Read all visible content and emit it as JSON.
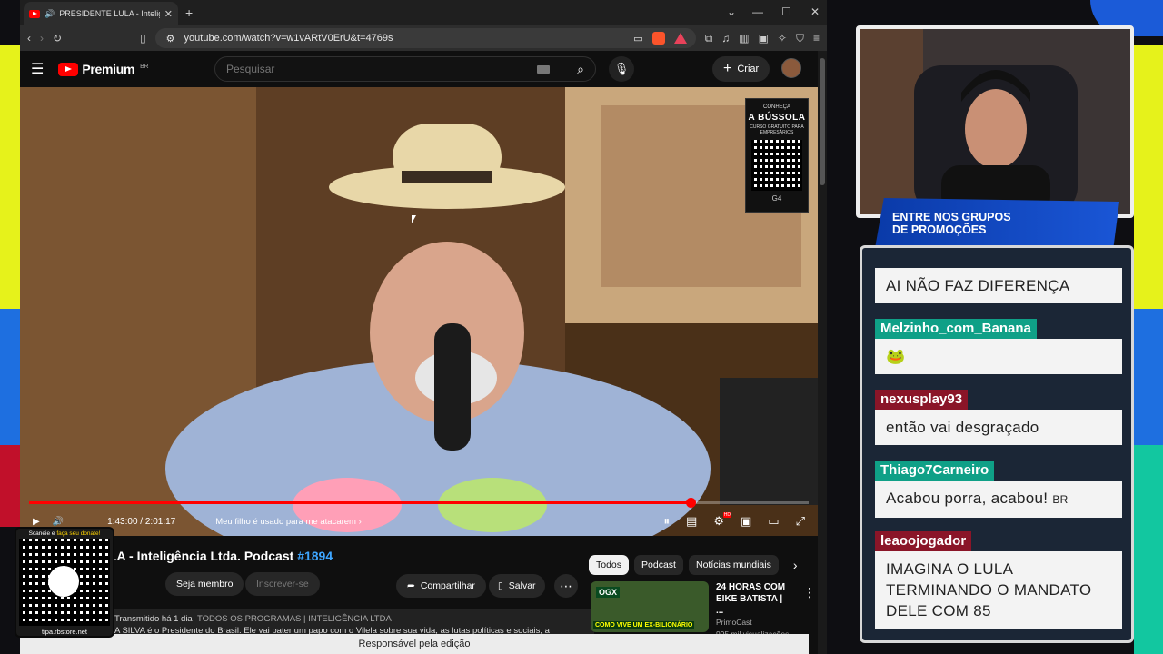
{
  "browser": {
    "tab_title": "PRESIDENTE LULA - Inteligência Ltd",
    "url": "youtube.com/watch?v=w1vARtV0ErU&t=4769s",
    "status_bar": "Responsável pela edição"
  },
  "youtube": {
    "logo_text": "Premium",
    "logo_region": "BR",
    "search_placeholder": "Pesquisar",
    "create_label": "Criar"
  },
  "ad_overlay": {
    "line1": "CONHEÇA",
    "brand": "A BÚSSOLA",
    "line2": "CURSO GRATUITO PARA EMPRESÁRIOS",
    "footer": "G4"
  },
  "player": {
    "time": "1:43:00 / 2:01:17",
    "chapter": "Meu filho é usado para me atacarem",
    "progress": 0.849
  },
  "video": {
    "title": "LA - Inteligência Ltda. Podcast ",
    "title_tag": "#1894",
    "member_label": "Seja membro",
    "subscribe_label": "Inscrever-se",
    "share_label": "Compartilhar",
    "save_label": "Salvar",
    "desc_meta": "Transmitido há 1 dia",
    "desc_tags": "TODOS OS PROGRAMAS | INTELIGÊNCIA LTDA",
    "desc_text": "A SILVA é o Presidente do Brasil. Ele vai bater um papo com o Vilela sobre sua vida, as lutas políticas e sociais, a"
  },
  "chips": [
    "Todos",
    "Podcast",
    "Notícias mundiais"
  ],
  "recommended": {
    "title": "24 HORAS COM EIKE BATISTA | ...",
    "channel": "PrimoCast",
    "meta": "995 mil visualizações • h...",
    "thumb_badge": "OGX",
    "thumb_caption": "COMO VIVE UM EX-BILIONÁRIO"
  },
  "qr_overlay": {
    "top_text": "Scaneie e ",
    "top_highlight": "faça seu donate!",
    "bottom_text": "tipa.rbstore.net"
  },
  "banner": {
    "line1": "ENTRE NOS GRUPOS",
    "line2": "DE PROMOÇÕES"
  },
  "chat": [
    {
      "user": "",
      "text": "AI NÃO FAZ DIFERENÇA",
      "color": "#0fa087"
    },
    {
      "user": "Melzinho_com_Banana",
      "text": "🐸",
      "color": "#0fa087"
    },
    {
      "user": "nexusplay93",
      "text": "então vai desgraçado",
      "color": "#8a1528"
    },
    {
      "user": "Thiago7Carneiro",
      "text": "Acabou porra, acabou!",
      "suffix": "BR",
      "color": "#0fa087"
    },
    {
      "user": "leaoojogador",
      "text": "IMAGINA O LULA TERMINANDO O MANDATO DELE COM 85",
      "color": "#8a1528"
    }
  ]
}
